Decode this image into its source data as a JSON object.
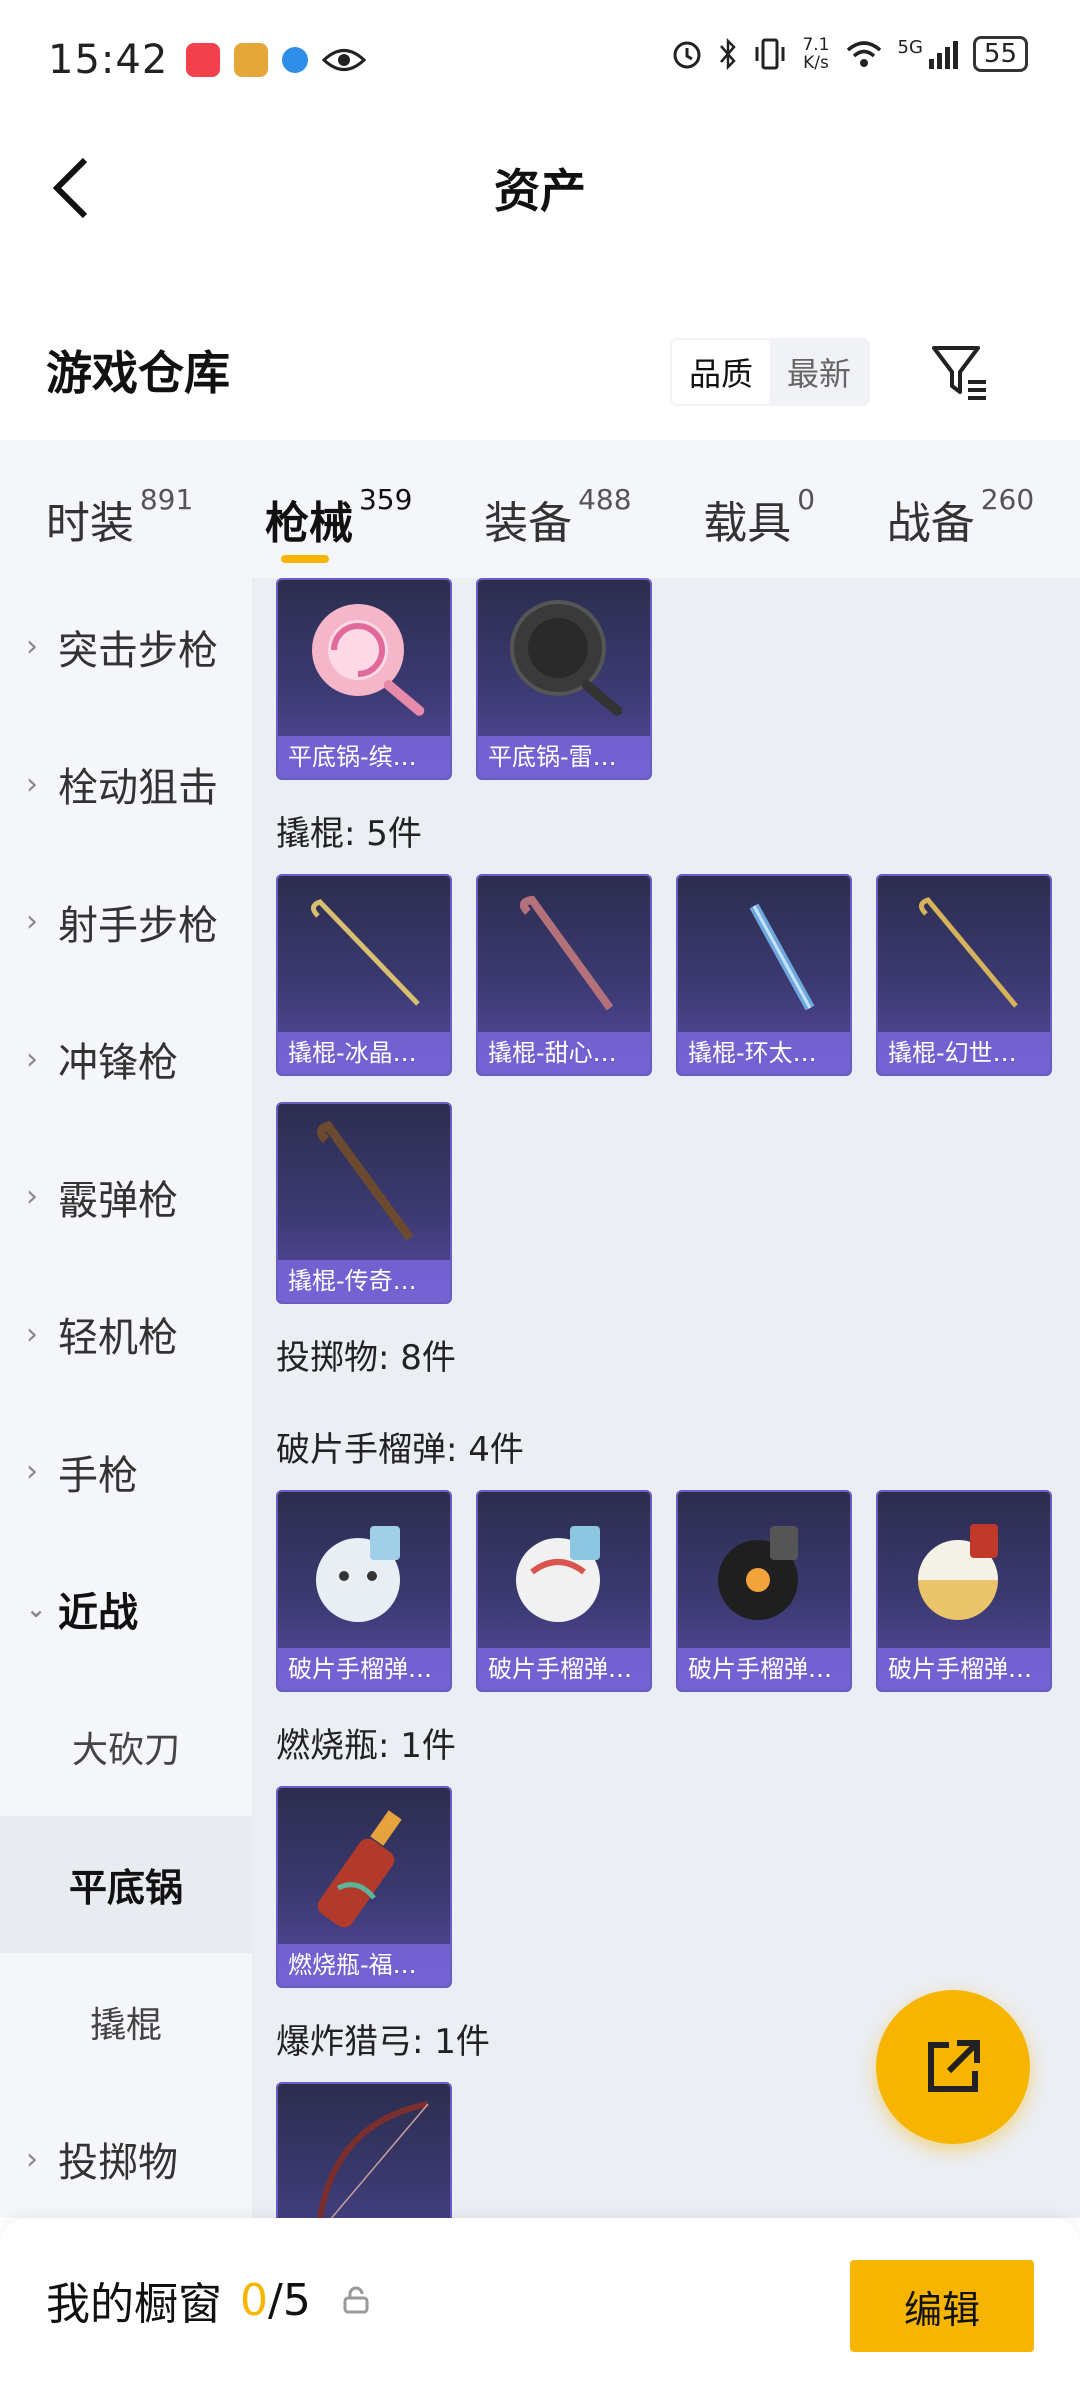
{
  "status_bar": {
    "time": "15:42",
    "net_speed_value": "7.1",
    "net_speed_unit": "K/s",
    "network": "5G",
    "battery": "55"
  },
  "header": {
    "title": "资产"
  },
  "warehouse": {
    "title": "游戏仓库",
    "sort_options": [
      "品质",
      "最新"
    ],
    "sort_selected": "品质"
  },
  "tabs": [
    {
      "label": "时装",
      "count": "891"
    },
    {
      "label": "枪械",
      "count": "359"
    },
    {
      "label": "装备",
      "count": "488"
    },
    {
      "label": "载具",
      "count": "0"
    },
    {
      "label": "战备",
      "count": "260"
    }
  ],
  "active_tab": "枪械",
  "sidebar": {
    "items": [
      {
        "label": "突击步枪",
        "type": "category"
      },
      {
        "label": "栓动狙击",
        "type": "category"
      },
      {
        "label": "射手步枪",
        "type": "category"
      },
      {
        "label": "冲锋枪",
        "type": "category"
      },
      {
        "label": "霰弹枪",
        "type": "category"
      },
      {
        "label": "轻机枪",
        "type": "category"
      },
      {
        "label": "手枪",
        "type": "category"
      },
      {
        "label": "近战",
        "type": "expanded"
      },
      {
        "label": "大砍刀",
        "type": "sub"
      },
      {
        "label": "平底锅",
        "type": "sub-active"
      },
      {
        "label": "撬棍",
        "type": "sub"
      },
      {
        "label": "投掷物",
        "type": "category"
      }
    ]
  },
  "content": {
    "sections": [
      {
        "label": "",
        "items": [
          "平底锅-缤纷…",
          "平底锅-雷霆…"
        ]
      },
      {
        "label": "撬棍: 5件",
        "items": [
          "撬棍-冰晶雪宝",
          "撬棍-甜心宝贝",
          "撬棍-环太平洋",
          "撬棍-幻世战…",
          "撬棍-传奇侦探"
        ]
      },
      {
        "label": "投掷物: 8件",
        "items": []
      },
      {
        "label": "破片手榴弹: 4件",
        "items": [
          "破片手榴弹-…",
          "破片手榴弹-…",
          "破片手榴弹-…",
          "破片手榴弹-…"
        ]
      },
      {
        "label": "燃烧瓶: 1件",
        "items": [
          "燃烧瓶-福马…"
        ]
      },
      {
        "label": "爆炸猎弓: 1件",
        "items": [
          ""
        ]
      }
    ]
  },
  "bottom_bar": {
    "title": "我的橱窗",
    "count_current": "0",
    "count_total": "/5",
    "edit_label": "编辑"
  },
  "colors": {
    "accent": "#f7b500",
    "card_bg": "#3b3a72",
    "card_label": "#7a66dc"
  }
}
